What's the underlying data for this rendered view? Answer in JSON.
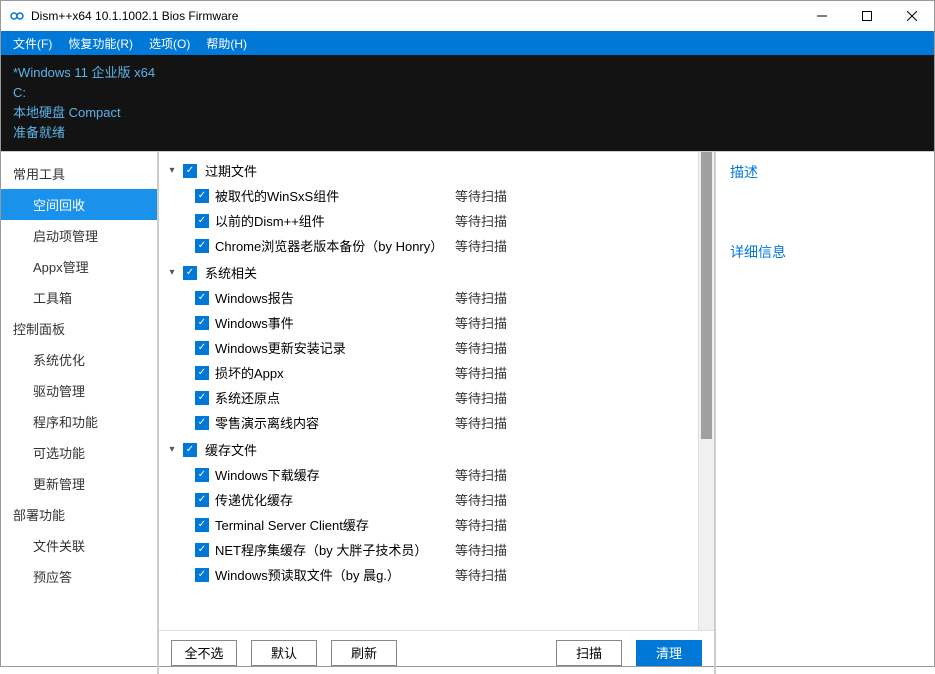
{
  "window": {
    "title": "Dism++x64 10.1.1002.1 Bios Firmware"
  },
  "menu": [
    "文件(F)",
    "恢复功能(R)",
    "选项(O)",
    "帮助(H)"
  ],
  "info": {
    "line1": "*Windows 11 企业版 x64",
    "line2": "C:",
    "line3": "本地硬盘 Compact",
    "line4": "准备就绪"
  },
  "sidebar": [
    {
      "type": "group",
      "label": "常用工具"
    },
    {
      "type": "item",
      "label": "空间回收",
      "active": true
    },
    {
      "type": "item",
      "label": "启动项管理"
    },
    {
      "type": "item",
      "label": "Appx管理"
    },
    {
      "type": "item",
      "label": "工具箱"
    },
    {
      "type": "group",
      "label": "控制面板"
    },
    {
      "type": "item",
      "label": "系统优化"
    },
    {
      "type": "item",
      "label": "驱动管理"
    },
    {
      "type": "item",
      "label": "程序和功能"
    },
    {
      "type": "item",
      "label": "可选功能"
    },
    {
      "type": "item",
      "label": "更新管理"
    },
    {
      "type": "group",
      "label": "部署功能"
    },
    {
      "type": "item",
      "label": "文件关联"
    },
    {
      "type": "item",
      "label": "预应答"
    }
  ],
  "tree": [
    {
      "label": "过期文件",
      "checked": true,
      "items": [
        {
          "label": "被取代的WinSxS组件",
          "status": "等待扫描",
          "checked": true
        },
        {
          "label": "以前的Dism++组件",
          "status": "等待扫描",
          "checked": true
        },
        {
          "label": "Chrome浏览器老版本备份（by Honry）",
          "status": "等待扫描",
          "checked": true
        }
      ]
    },
    {
      "label": "系统相关",
      "checked": true,
      "items": [
        {
          "label": "Windows报告",
          "status": "等待扫描",
          "checked": true
        },
        {
          "label": "Windows事件",
          "status": "等待扫描",
          "checked": true
        },
        {
          "label": "Windows更新安装记录",
          "status": "等待扫描",
          "checked": true
        },
        {
          "label": "损坏的Appx",
          "status": "等待扫描",
          "checked": true
        },
        {
          "label": "系统还原点",
          "status": "等待扫描",
          "checked": true
        },
        {
          "label": "零售演示离线内容",
          "status": "等待扫描",
          "checked": true
        }
      ]
    },
    {
      "label": "缓存文件",
      "checked": true,
      "items": [
        {
          "label": "Windows下载缓存",
          "status": "等待扫描",
          "checked": true
        },
        {
          "label": "传递优化缓存",
          "status": "等待扫描",
          "checked": true
        },
        {
          "label": "Terminal Server Client缓存",
          "status": "等待扫描",
          "checked": true
        },
        {
          "label": "NET程序集缓存（by 大胖子技术员）",
          "status": "等待扫描",
          "checked": true
        },
        {
          "label": "Windows预读取文件（by 晨g.）",
          "status": "等待扫描",
          "checked": true
        }
      ]
    }
  ],
  "buttons": {
    "deselect_all": "全不选",
    "default": "默认",
    "refresh": "刷新",
    "scan": "扫描",
    "clean": "清理"
  },
  "right": {
    "description": "描述",
    "details": "详细信息"
  }
}
